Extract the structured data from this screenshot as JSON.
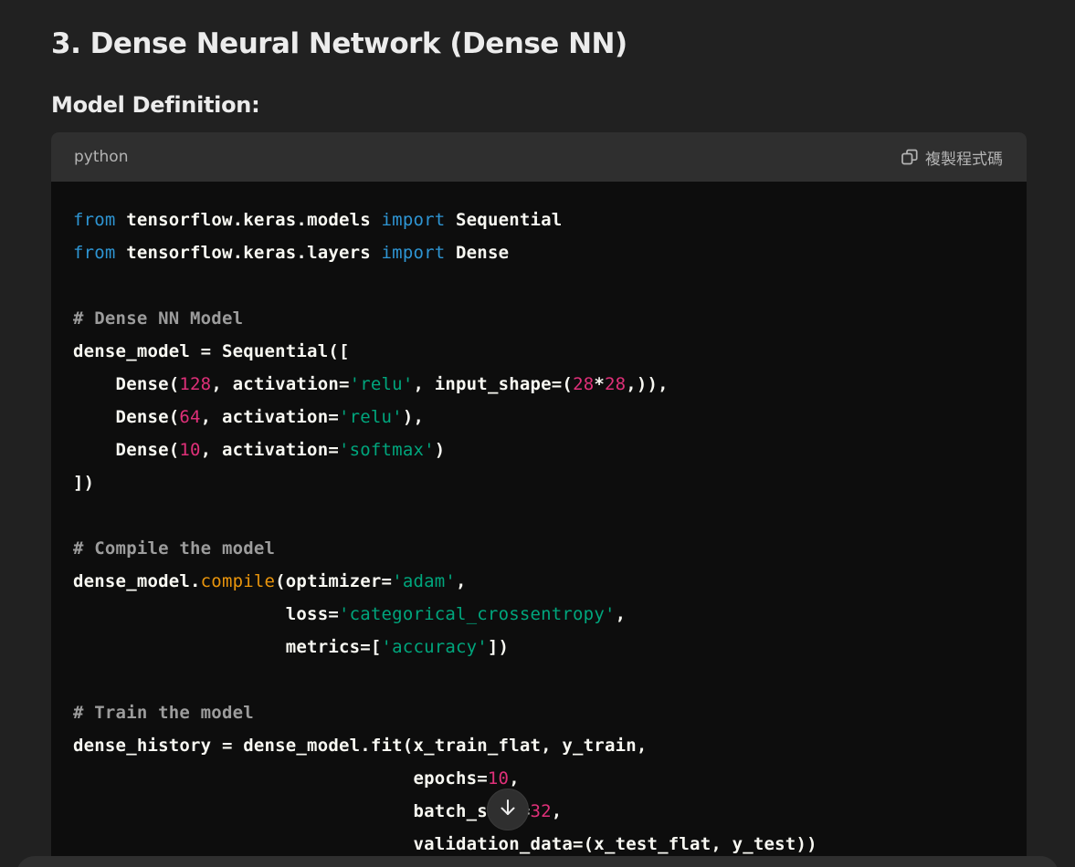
{
  "section_title": "3. Dense Neural Network (Dense NN)",
  "subheading": "Model Definition:",
  "code_block": {
    "language": "python",
    "copy_label": "複製程式碼",
    "lines": [
      [
        {
          "t": "kw",
          "v": "from"
        },
        {
          "t": "p",
          "v": " tensorflow.keras.models "
        },
        {
          "t": "kw",
          "v": "import"
        },
        {
          "t": "p",
          "v": " Sequential"
        }
      ],
      [
        {
          "t": "kw",
          "v": "from"
        },
        {
          "t": "p",
          "v": " tensorflow.keras.layers "
        },
        {
          "t": "kw",
          "v": "import"
        },
        {
          "t": "p",
          "v": " Dense"
        }
      ],
      [],
      [
        {
          "t": "cm",
          "v": "# Dense NN Model"
        }
      ],
      [
        {
          "t": "p",
          "v": "dense_model = Sequential(["
        }
      ],
      [
        {
          "t": "p",
          "v": "    Dense("
        },
        {
          "t": "num",
          "v": "128"
        },
        {
          "t": "p",
          "v": ", activation="
        },
        {
          "t": "str",
          "v": "'relu'"
        },
        {
          "t": "p",
          "v": ", input_shape=("
        },
        {
          "t": "num",
          "v": "28"
        },
        {
          "t": "p",
          "v": "*"
        },
        {
          "t": "num",
          "v": "28"
        },
        {
          "t": "p",
          "v": ",)),"
        }
      ],
      [
        {
          "t": "p",
          "v": "    Dense("
        },
        {
          "t": "num",
          "v": "64"
        },
        {
          "t": "p",
          "v": ", activation="
        },
        {
          "t": "str",
          "v": "'relu'"
        },
        {
          "t": "p",
          "v": "),"
        }
      ],
      [
        {
          "t": "p",
          "v": "    Dense("
        },
        {
          "t": "num",
          "v": "10"
        },
        {
          "t": "p",
          "v": ", activation="
        },
        {
          "t": "str",
          "v": "'softmax'"
        },
        {
          "t": "p",
          "v": ")"
        }
      ],
      [
        {
          "t": "p",
          "v": "])"
        }
      ],
      [],
      [
        {
          "t": "cm",
          "v": "# Compile the model"
        }
      ],
      [
        {
          "t": "p",
          "v": "dense_model."
        },
        {
          "t": "fn",
          "v": "compile"
        },
        {
          "t": "p",
          "v": "(optimizer="
        },
        {
          "t": "str",
          "v": "'adam'"
        },
        {
          "t": "p",
          "v": ","
        }
      ],
      [
        {
          "t": "p",
          "v": "                    loss="
        },
        {
          "t": "str",
          "v": "'categorical_crossentropy'"
        },
        {
          "t": "p",
          "v": ","
        }
      ],
      [
        {
          "t": "p",
          "v": "                    metrics=["
        },
        {
          "t": "str",
          "v": "'accuracy'"
        },
        {
          "t": "p",
          "v": "])"
        }
      ],
      [],
      [
        {
          "t": "cm",
          "v": "# Train the model"
        }
      ],
      [
        {
          "t": "p",
          "v": "dense_history = dense_model.fit(x_train_flat, y_train,"
        }
      ],
      [
        {
          "t": "p",
          "v": "                                epochs="
        },
        {
          "t": "num",
          "v": "10"
        },
        {
          "t": "p",
          "v": ","
        }
      ],
      [
        {
          "t": "p",
          "v": "                                batch_size="
        },
        {
          "t": "num",
          "v": "32"
        },
        {
          "t": "p",
          "v": ","
        }
      ],
      [
        {
          "t": "p",
          "v": "                                validation_data=(x_test_flat, y_test))"
        }
      ]
    ]
  },
  "icons": {
    "copy": "copy-icon",
    "scroll_down": "arrow-down-icon"
  },
  "colors": {
    "background": "#212121",
    "code_header": "#2f2f2f",
    "code_body": "#0d0d0d",
    "keyword": "#2e95d3",
    "number": "#df3079",
    "string": "#00a67d",
    "comment": "#9c9c9c",
    "function": "#e9950c"
  }
}
